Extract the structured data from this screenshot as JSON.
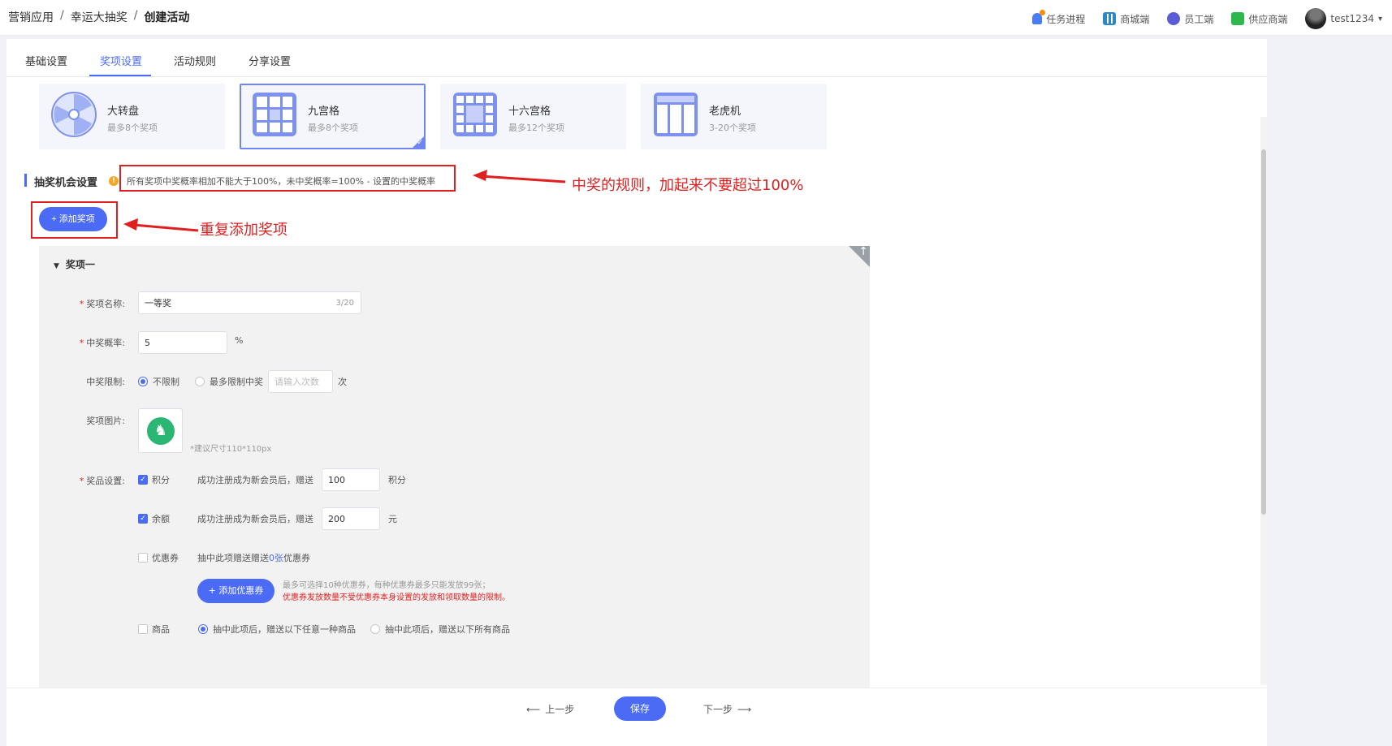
{
  "breadcrumb": [
    "营销应用",
    "幸运大抽奖",
    "创建活动"
  ],
  "breadcrumb_sep": "/",
  "topbar": {
    "tasks": "任务进程",
    "mall": "商城端",
    "staff": "员工端",
    "supplier": "供应商端",
    "user": "test1234"
  },
  "tabs": [
    "基础设置",
    "奖项设置",
    "活动规则",
    "分享设置"
  ],
  "active_tab": "奖项设置",
  "game_types": [
    {
      "title": "大转盘",
      "sub": "最多8个奖项",
      "icon": "wheel-icon"
    },
    {
      "title": "九宫格",
      "sub": "最多8个奖项",
      "icon": "grid9-icon",
      "selected": true
    },
    {
      "title": "十六宫格",
      "sub": "最多12个奖项",
      "icon": "grid16-icon"
    },
    {
      "title": "老虎机",
      "sub": "3-20个奖项",
      "icon": "slot-icon"
    }
  ],
  "section": {
    "title": "抽奖机会设置",
    "warning": "所有奖项中奖概率相加不能大于100%，未中奖概率=100% - 设置的中奖概率"
  },
  "add_prize_label": "+ 添加奖项",
  "annotations": {
    "rule": "中奖的规则，加起来不要超过100%",
    "repeat": "重复添加奖项"
  },
  "prize": {
    "header": "奖项一",
    "name_label": "奖项名称:",
    "name_value": "一等奖",
    "name_count": "3/20",
    "prob_label": "中奖概率:",
    "prob_value": "5",
    "prob_unit": "%",
    "limit_label": "中奖限制:",
    "limit_opt1": "不限制",
    "limit_opt2": "最多限制中奖",
    "limit_placeholder": "请输入次数",
    "limit_unit": "次",
    "img_label": "奖项图片:",
    "img_hint": "*建议尺寸110*110px",
    "gift_label": "奖品设置:",
    "points": {
      "label": "积分",
      "text": "成功注册成为新会员后，赠送",
      "value": "100",
      "unit": "积分",
      "checked": true
    },
    "balance": {
      "label": "余额",
      "text": "成功注册成为新会员后，赠送",
      "value": "200",
      "unit": "元",
      "checked": true
    },
    "coupon": {
      "label": "优惠券",
      "text_a": "抽中此项赠送赠送",
      "count": "0张",
      "text_b": "优惠券",
      "checked": false
    },
    "coupon_btn": "+ 添加优惠券",
    "coupon_note1": "最多可选择10种优惠券，每种优惠券最多只能发放99张；",
    "coupon_note2": "优惠券发放数量不受优惠券本身设置的发放和领取数量的限制。",
    "goods": {
      "label": "商品",
      "opt1": "抽中此项后，赠送以下任意一种商品",
      "opt2": "抽中此项后，赠送以下所有商品",
      "checked": false
    }
  },
  "footer": {
    "prev": "上一步",
    "save": "保存",
    "next": "下一步"
  },
  "colors": {
    "primary": "#4b6bf5",
    "annotation": "#e02020",
    "warning": "#f5a623"
  }
}
